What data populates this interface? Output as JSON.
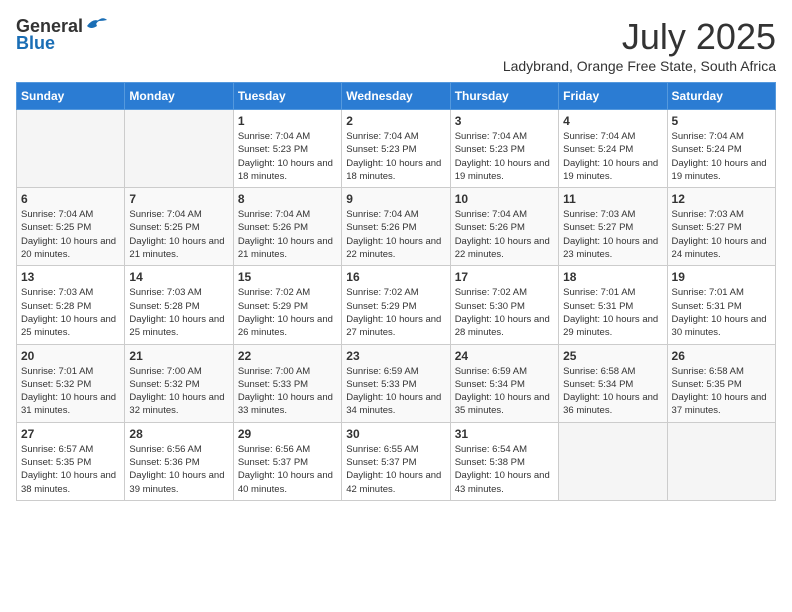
{
  "header": {
    "logo_general": "General",
    "logo_blue": "Blue",
    "month_title": "July 2025",
    "location": "Ladybrand, Orange Free State, South Africa"
  },
  "weekdays": [
    "Sunday",
    "Monday",
    "Tuesday",
    "Wednesday",
    "Thursday",
    "Friday",
    "Saturday"
  ],
  "weeks": [
    [
      {
        "day": "",
        "info": ""
      },
      {
        "day": "",
        "info": ""
      },
      {
        "day": "1",
        "info": "Sunrise: 7:04 AM\nSunset: 5:23 PM\nDaylight: 10 hours and 18 minutes."
      },
      {
        "day": "2",
        "info": "Sunrise: 7:04 AM\nSunset: 5:23 PM\nDaylight: 10 hours and 18 minutes."
      },
      {
        "day": "3",
        "info": "Sunrise: 7:04 AM\nSunset: 5:23 PM\nDaylight: 10 hours and 19 minutes."
      },
      {
        "day": "4",
        "info": "Sunrise: 7:04 AM\nSunset: 5:24 PM\nDaylight: 10 hours and 19 minutes."
      },
      {
        "day": "5",
        "info": "Sunrise: 7:04 AM\nSunset: 5:24 PM\nDaylight: 10 hours and 19 minutes."
      }
    ],
    [
      {
        "day": "6",
        "info": "Sunrise: 7:04 AM\nSunset: 5:25 PM\nDaylight: 10 hours and 20 minutes."
      },
      {
        "day": "7",
        "info": "Sunrise: 7:04 AM\nSunset: 5:25 PM\nDaylight: 10 hours and 21 minutes."
      },
      {
        "day": "8",
        "info": "Sunrise: 7:04 AM\nSunset: 5:26 PM\nDaylight: 10 hours and 21 minutes."
      },
      {
        "day": "9",
        "info": "Sunrise: 7:04 AM\nSunset: 5:26 PM\nDaylight: 10 hours and 22 minutes."
      },
      {
        "day": "10",
        "info": "Sunrise: 7:04 AM\nSunset: 5:26 PM\nDaylight: 10 hours and 22 minutes."
      },
      {
        "day": "11",
        "info": "Sunrise: 7:03 AM\nSunset: 5:27 PM\nDaylight: 10 hours and 23 minutes."
      },
      {
        "day": "12",
        "info": "Sunrise: 7:03 AM\nSunset: 5:27 PM\nDaylight: 10 hours and 24 minutes."
      }
    ],
    [
      {
        "day": "13",
        "info": "Sunrise: 7:03 AM\nSunset: 5:28 PM\nDaylight: 10 hours and 25 minutes."
      },
      {
        "day": "14",
        "info": "Sunrise: 7:03 AM\nSunset: 5:28 PM\nDaylight: 10 hours and 25 minutes."
      },
      {
        "day": "15",
        "info": "Sunrise: 7:02 AM\nSunset: 5:29 PM\nDaylight: 10 hours and 26 minutes."
      },
      {
        "day": "16",
        "info": "Sunrise: 7:02 AM\nSunset: 5:29 PM\nDaylight: 10 hours and 27 minutes."
      },
      {
        "day": "17",
        "info": "Sunrise: 7:02 AM\nSunset: 5:30 PM\nDaylight: 10 hours and 28 minutes."
      },
      {
        "day": "18",
        "info": "Sunrise: 7:01 AM\nSunset: 5:31 PM\nDaylight: 10 hours and 29 minutes."
      },
      {
        "day": "19",
        "info": "Sunrise: 7:01 AM\nSunset: 5:31 PM\nDaylight: 10 hours and 30 minutes."
      }
    ],
    [
      {
        "day": "20",
        "info": "Sunrise: 7:01 AM\nSunset: 5:32 PM\nDaylight: 10 hours and 31 minutes."
      },
      {
        "day": "21",
        "info": "Sunrise: 7:00 AM\nSunset: 5:32 PM\nDaylight: 10 hours and 32 minutes."
      },
      {
        "day": "22",
        "info": "Sunrise: 7:00 AM\nSunset: 5:33 PM\nDaylight: 10 hours and 33 minutes."
      },
      {
        "day": "23",
        "info": "Sunrise: 6:59 AM\nSunset: 5:33 PM\nDaylight: 10 hours and 34 minutes."
      },
      {
        "day": "24",
        "info": "Sunrise: 6:59 AM\nSunset: 5:34 PM\nDaylight: 10 hours and 35 minutes."
      },
      {
        "day": "25",
        "info": "Sunrise: 6:58 AM\nSunset: 5:34 PM\nDaylight: 10 hours and 36 minutes."
      },
      {
        "day": "26",
        "info": "Sunrise: 6:58 AM\nSunset: 5:35 PM\nDaylight: 10 hours and 37 minutes."
      }
    ],
    [
      {
        "day": "27",
        "info": "Sunrise: 6:57 AM\nSunset: 5:35 PM\nDaylight: 10 hours and 38 minutes."
      },
      {
        "day": "28",
        "info": "Sunrise: 6:56 AM\nSunset: 5:36 PM\nDaylight: 10 hours and 39 minutes."
      },
      {
        "day": "29",
        "info": "Sunrise: 6:56 AM\nSunset: 5:37 PM\nDaylight: 10 hours and 40 minutes."
      },
      {
        "day": "30",
        "info": "Sunrise: 6:55 AM\nSunset: 5:37 PM\nDaylight: 10 hours and 42 minutes."
      },
      {
        "day": "31",
        "info": "Sunrise: 6:54 AM\nSunset: 5:38 PM\nDaylight: 10 hours and 43 minutes."
      },
      {
        "day": "",
        "info": ""
      },
      {
        "day": "",
        "info": ""
      }
    ]
  ]
}
